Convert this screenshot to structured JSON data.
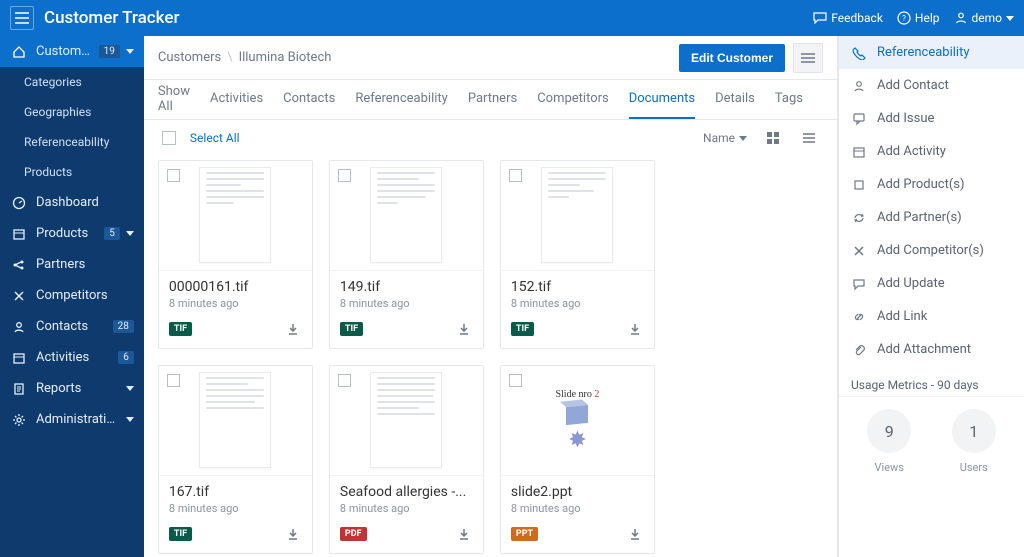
{
  "app": {
    "title": "Customer Tracker"
  },
  "top": {
    "feedback": "Feedback",
    "help": "Help",
    "user": "demo"
  },
  "sidebar": {
    "items": [
      {
        "label": "Customers",
        "badge": "19",
        "icon": "home",
        "children": [
          {
            "label": "Categories"
          },
          {
            "label": "Geographies"
          },
          {
            "label": "Referenceability"
          },
          {
            "label": "Products"
          }
        ]
      },
      {
        "label": "Dashboard",
        "icon": "gauge"
      },
      {
        "label": "Products",
        "badge": "5",
        "icon": "box",
        "chev": true
      },
      {
        "label": "Partners",
        "icon": "share"
      },
      {
        "label": "Competitors",
        "icon": "x"
      },
      {
        "label": "Contacts",
        "badge": "28",
        "icon": "person"
      },
      {
        "label": "Activities",
        "badge": "6",
        "icon": "calendar"
      },
      {
        "label": "Reports",
        "icon": "doc",
        "chev": true
      },
      {
        "label": "Administration",
        "icon": "gear",
        "chev": true
      }
    ]
  },
  "breadcrumb": {
    "root": "Customers",
    "current": "Illumina Biotech"
  },
  "buttons": {
    "edit": "Edit Customer"
  },
  "tabs": [
    "Show All",
    "Activities",
    "Contacts",
    "Referenceability",
    "Partners",
    "Competitors",
    "Documents",
    "Details",
    "Tags"
  ],
  "activeTab": "Documents",
  "docsHeader": {
    "selectAll": "Select All",
    "sort": "Name"
  },
  "documents": [
    {
      "title": "00000161.tif",
      "time": "8 minutes ago",
      "type": "TIF"
    },
    {
      "title": "149.tif",
      "time": "8 minutes ago",
      "type": "TIF"
    },
    {
      "title": "152.tif",
      "time": "8 minutes ago",
      "type": "TIF"
    },
    {
      "title": "167.tif",
      "time": "8 minutes ago",
      "type": "TIF"
    },
    {
      "title": "Seafood allergies -...",
      "time": "8 minutes ago",
      "type": "PDF"
    },
    {
      "title": "slide2.ppt",
      "time": "8 minutes ago",
      "type": "PPT"
    }
  ],
  "slideThumb": {
    "title_prefix": "Slide nro ",
    "title_num": "2"
  },
  "rightActions": [
    {
      "label": "Referenceability",
      "icon": "phone"
    },
    {
      "label": "Add Contact",
      "icon": "person"
    },
    {
      "label": "Add Issue",
      "icon": "chat"
    },
    {
      "label": "Add Activity",
      "icon": "cal"
    },
    {
      "label": "Add Product(s)",
      "icon": "square"
    },
    {
      "label": "Add Partner(s)",
      "icon": "cycle"
    },
    {
      "label": "Add Competitor(s)",
      "icon": "x"
    },
    {
      "label": "Add Update",
      "icon": "bubble"
    },
    {
      "label": "Add Link",
      "icon": "link"
    },
    {
      "label": "Add Attachment",
      "icon": "clip"
    }
  ],
  "usage": {
    "title": "Usage Metrics - 90 days",
    "views": {
      "value": "9",
      "label": "Views"
    },
    "users": {
      "value": "1",
      "label": "Users"
    }
  }
}
